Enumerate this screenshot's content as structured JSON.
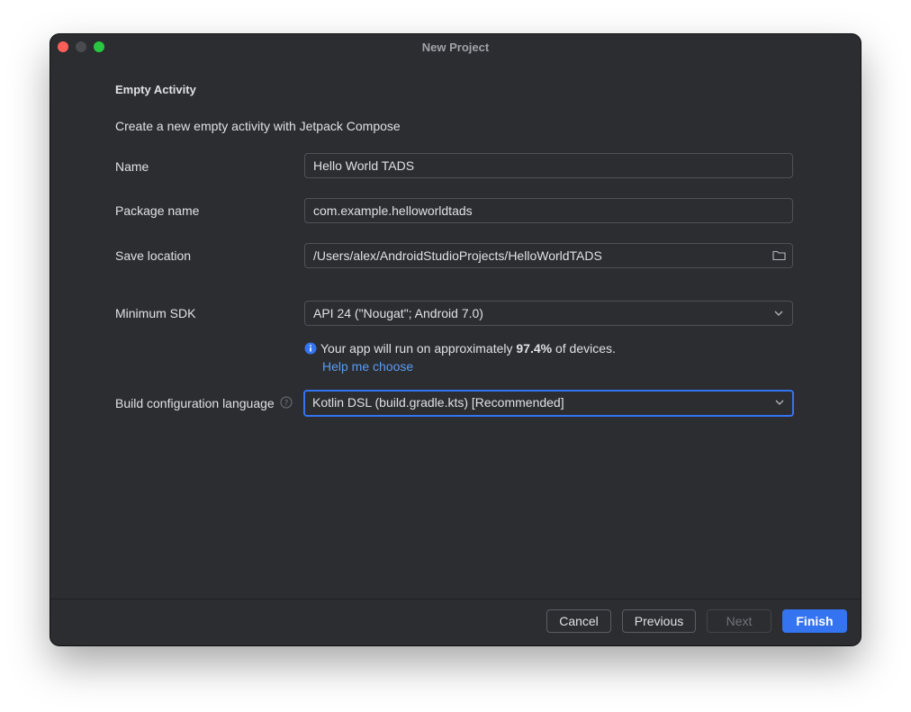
{
  "window": {
    "title": "New Project"
  },
  "page": {
    "heading": "Empty Activity",
    "description": "Create a new empty activity with Jetpack Compose"
  },
  "form": {
    "name": {
      "label": "Name",
      "value": "Hello World TADS"
    },
    "package": {
      "label": "Package name",
      "value": "com.example.helloworldtads"
    },
    "location": {
      "label": "Save location",
      "value": "/Users/alex/AndroidStudioProjects/HelloWorldTADS"
    },
    "min_sdk": {
      "label": "Minimum SDK",
      "value": "API 24 (\"Nougat\"; Android 7.0)"
    },
    "build_lang": {
      "label": "Build configuration language",
      "value": "Kotlin DSL (build.gradle.kts) [Recommended]"
    }
  },
  "info": {
    "prefix": "Your app will run on approximately ",
    "percent": "97.4%",
    "suffix": " of devices.",
    "help_link": "Help me choose"
  },
  "footer": {
    "cancel": "Cancel",
    "previous": "Previous",
    "next": "Next",
    "finish": "Finish"
  },
  "colors": {
    "background": "#2b2d30",
    "accent": "#3574f0",
    "link": "#589df6",
    "close": "#ff5f57",
    "maximize": "#28c840"
  }
}
